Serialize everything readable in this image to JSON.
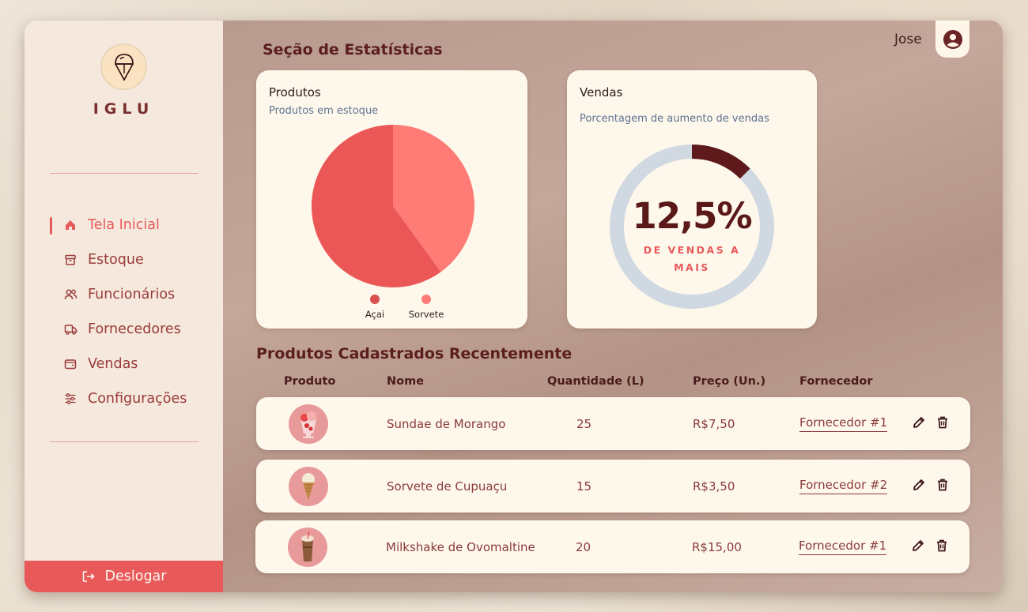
{
  "brand": {
    "name": "IGLU"
  },
  "sidebar": {
    "items": [
      {
        "label": "Tela Inicial",
        "icon": "home-icon"
      },
      {
        "label": "Estoque",
        "icon": "archive-icon"
      },
      {
        "label": "Funcionários",
        "icon": "users-icon"
      },
      {
        "label": "Fornecedores",
        "icon": "truck-icon"
      },
      {
        "label": "Vendas",
        "icon": "wallet-icon"
      },
      {
        "label": "Configurações",
        "icon": "sliders-icon"
      }
    ],
    "active": "Tela Inicial",
    "logout_label": "Deslogar"
  },
  "header": {
    "section_title": "Seção de Estatísticas",
    "user_name": "Jose"
  },
  "products_card": {
    "title": "Produtos",
    "subtitle": "Produtos em estoque",
    "legend": [
      {
        "label": "Açai",
        "color": "#d95050"
      },
      {
        "label": "Sorvete",
        "color": "#ff7b76"
      }
    ]
  },
  "sales_card": {
    "title": "Vendas",
    "subtitle": "Porcentagem de aumento de vendas",
    "value_text": "12,5%",
    "caption_line1": "DE VENDAS A",
    "caption_line2": "MAIS",
    "progress": 0.125
  },
  "chart_data": {
    "type": "pie",
    "categories": [
      "Açai",
      "Sorvete"
    ],
    "values": [
      60,
      40
    ],
    "colors": [
      "#eb5757",
      "#ff7b76"
    ]
  },
  "table": {
    "title": "Produtos Cadastrados Recentemente",
    "columns": [
      "Produto",
      "Nome",
      "Quantidade (L)",
      "Preço (Un.)",
      "Fornecedor"
    ],
    "rows": [
      {
        "name": "Sundae de Morango",
        "quantity": "25",
        "price": "R$7,50",
        "supplier": "Fornecedor #1"
      },
      {
        "name": "Sorvete de Cupuaçu",
        "quantity": "15",
        "price": "R$3,50",
        "supplier": "Fornecedor #2"
      },
      {
        "name": "Milkshake de Ovomaltine",
        "quantity": "20",
        "price": "R$15,00",
        "supplier": "Fornecedor #1"
      }
    ]
  },
  "colors": {
    "accent": "#e85a5a",
    "dark": "#5a1e1e",
    "card": "#fef8ec",
    "ring_track": "#d0d9e1",
    "ring_fill": "#5e1a1a"
  }
}
